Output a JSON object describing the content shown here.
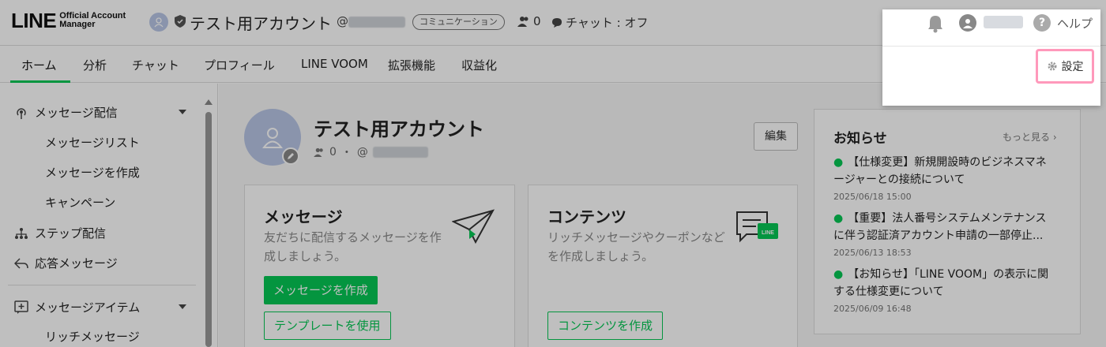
{
  "header": {
    "logo_main": "LINE",
    "logo_sub": "Official Account Manager",
    "account_name": "テスト用アカウント",
    "account_id_prefix": "@",
    "badge": "コミュニケーション",
    "friend_count": "0",
    "chat_status": "チャット : オフ"
  },
  "nav": {
    "items": [
      "ホーム",
      "分析",
      "チャット",
      "プロフィール",
      "LINE VOOM",
      "拡張機能",
      "収益化"
    ]
  },
  "sidebar": {
    "message_delivery": "メッセージ配信",
    "message_list": "メッセージリスト",
    "create_message": "メッセージを作成",
    "campaign": "キャンペーン",
    "step_delivery": "ステップ配信",
    "auto_response": "応答メッセージ",
    "message_items": "メッセージアイテム",
    "rich_message": "リッチメッセージ"
  },
  "profile": {
    "name": "テスト用アカウント",
    "friends": "0",
    "separator": "・",
    "id_prefix": "@",
    "edit": "編集"
  },
  "cards": {
    "message": {
      "title": "メッセージ",
      "desc1": "友だちに配信するメッセージを作",
      "desc2": "成しましょう。",
      "primary": "メッセージを作成",
      "secondary": "テンプレートを使用"
    },
    "content": {
      "title": "コンテンツ",
      "desc1": "リッチメッセージやクーポンなど",
      "desc2": "を作成しましょう。",
      "primary": "コンテンツを作成"
    }
  },
  "news": {
    "title": "お知らせ",
    "more": "もっと見る",
    "items": [
      {
        "line1": "【仕様変更】新規開設時のビジネスマネ",
        "line2": "ージャーとの接続について",
        "date": "2025/06/18 15:00"
      },
      {
        "line1": "【重要】法人番号システムメンテナンス",
        "line2": "に伴う認証済アカウント申請の一部停止...",
        "date": "2025/06/13 18:53"
      },
      {
        "line1": "【お知らせ】「LINE VOOM」の表示に関",
        "line2": "する仕様変更について",
        "date": "2025/06/09 16:48"
      }
    ]
  },
  "popup": {
    "help": "ヘルプ",
    "help_glyph": "?",
    "settings": "設定"
  },
  "colors": {
    "brand_green": "#06c755",
    "highlight_pink": "#ff99bb"
  }
}
